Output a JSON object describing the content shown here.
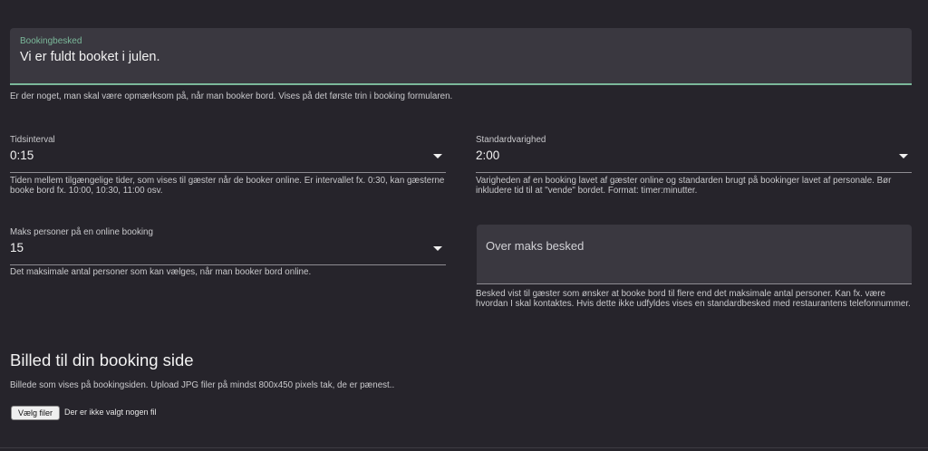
{
  "booking_message": {
    "label": "Bookingbesked",
    "value": "Vi er fuldt booket i julen.",
    "helper": "Er der noget, man skal være opmærksom på, når man booker bord. Vises på det første trin i booking formularen."
  },
  "time_interval": {
    "label": "Tidsinterval",
    "value": "0:15",
    "helper": "Tiden mellem tilgængelige tider, som vises til gæster når de booker online. Er intervallet fx. 0:30, kan gæsterne booke bord fx. 10:00, 10:30, 11:00 osv."
  },
  "default_duration": {
    "label": "Standardvarighed",
    "value": "2:00",
    "helper": "Varigheden af en booking lavet af gæster online og standarden brugt på bookinger lavet af personale. Bør inkludere tid til at \"vende\" bordet. Format: timer:minutter."
  },
  "max_persons": {
    "label": "Maks personer på en online booking",
    "value": "15",
    "helper": "Det maksimale antal personer som kan vælges, når man booker bord online."
  },
  "over_max_message": {
    "placeholder": "Over maks besked",
    "helper": "Besked vist til gæster som ønsker at booke bord til flere end det maksimale antal personer. Kan fx. være hvordan I skal kontaktes. Hvis dette ikke udfyldes vises en standardbesked med restaurantens telefonnummer."
  },
  "booking_image": {
    "title": "Billed til din booking side",
    "description": "Billede som vises på bookingsiden. Upload JPG filer på mindst 800x450 pixels tak, de er pænest..",
    "button_label": "Vælg filer",
    "file_status": "Der er ikke valgt nogen fil"
  },
  "colors": {
    "background": "#26242b",
    "field_fill": "#3a3840",
    "accent": "#7bb89a"
  }
}
